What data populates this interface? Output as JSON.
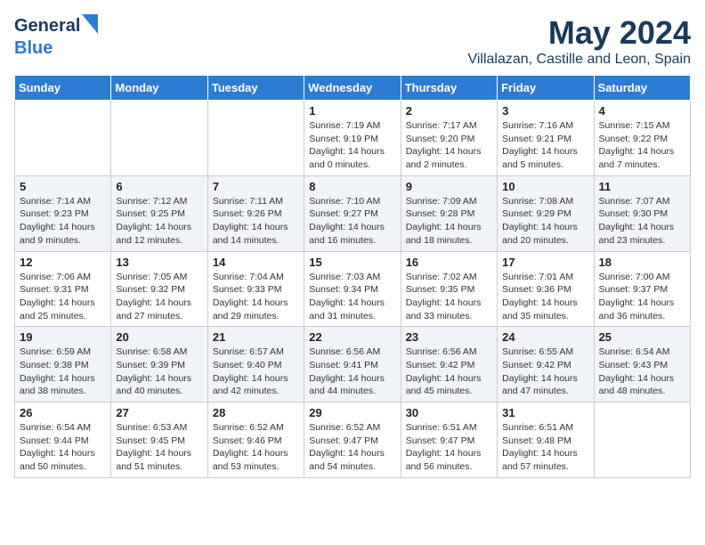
{
  "logo": {
    "general": "General",
    "blue": "Blue"
  },
  "title": "May 2024",
  "location": "Villalazan, Castille and Leon, Spain",
  "days_of_week": [
    "Sunday",
    "Monday",
    "Tuesday",
    "Wednesday",
    "Thursday",
    "Friday",
    "Saturday"
  ],
  "weeks": [
    [
      {
        "day": "",
        "info": ""
      },
      {
        "day": "",
        "info": ""
      },
      {
        "day": "",
        "info": ""
      },
      {
        "day": "1",
        "info": "Sunrise: 7:19 AM\nSunset: 9:19 PM\nDaylight: 14 hours and 0 minutes."
      },
      {
        "day": "2",
        "info": "Sunrise: 7:17 AM\nSunset: 9:20 PM\nDaylight: 14 hours and 2 minutes."
      },
      {
        "day": "3",
        "info": "Sunrise: 7:16 AM\nSunset: 9:21 PM\nDaylight: 14 hours and 5 minutes."
      },
      {
        "day": "4",
        "info": "Sunrise: 7:15 AM\nSunset: 9:22 PM\nDaylight: 14 hours and 7 minutes."
      }
    ],
    [
      {
        "day": "5",
        "info": "Sunrise: 7:14 AM\nSunset: 9:23 PM\nDaylight: 14 hours and 9 minutes."
      },
      {
        "day": "6",
        "info": "Sunrise: 7:12 AM\nSunset: 9:25 PM\nDaylight: 14 hours and 12 minutes."
      },
      {
        "day": "7",
        "info": "Sunrise: 7:11 AM\nSunset: 9:26 PM\nDaylight: 14 hours and 14 minutes."
      },
      {
        "day": "8",
        "info": "Sunrise: 7:10 AM\nSunset: 9:27 PM\nDaylight: 14 hours and 16 minutes."
      },
      {
        "day": "9",
        "info": "Sunrise: 7:09 AM\nSunset: 9:28 PM\nDaylight: 14 hours and 18 minutes."
      },
      {
        "day": "10",
        "info": "Sunrise: 7:08 AM\nSunset: 9:29 PM\nDaylight: 14 hours and 20 minutes."
      },
      {
        "day": "11",
        "info": "Sunrise: 7:07 AM\nSunset: 9:30 PM\nDaylight: 14 hours and 23 minutes."
      }
    ],
    [
      {
        "day": "12",
        "info": "Sunrise: 7:06 AM\nSunset: 9:31 PM\nDaylight: 14 hours and 25 minutes."
      },
      {
        "day": "13",
        "info": "Sunrise: 7:05 AM\nSunset: 9:32 PM\nDaylight: 14 hours and 27 minutes."
      },
      {
        "day": "14",
        "info": "Sunrise: 7:04 AM\nSunset: 9:33 PM\nDaylight: 14 hours and 29 minutes."
      },
      {
        "day": "15",
        "info": "Sunrise: 7:03 AM\nSunset: 9:34 PM\nDaylight: 14 hours and 31 minutes."
      },
      {
        "day": "16",
        "info": "Sunrise: 7:02 AM\nSunset: 9:35 PM\nDaylight: 14 hours and 33 minutes."
      },
      {
        "day": "17",
        "info": "Sunrise: 7:01 AM\nSunset: 9:36 PM\nDaylight: 14 hours and 35 minutes."
      },
      {
        "day": "18",
        "info": "Sunrise: 7:00 AM\nSunset: 9:37 PM\nDaylight: 14 hours and 36 minutes."
      }
    ],
    [
      {
        "day": "19",
        "info": "Sunrise: 6:59 AM\nSunset: 9:38 PM\nDaylight: 14 hours and 38 minutes."
      },
      {
        "day": "20",
        "info": "Sunrise: 6:58 AM\nSunset: 9:39 PM\nDaylight: 14 hours and 40 minutes."
      },
      {
        "day": "21",
        "info": "Sunrise: 6:57 AM\nSunset: 9:40 PM\nDaylight: 14 hours and 42 minutes."
      },
      {
        "day": "22",
        "info": "Sunrise: 6:56 AM\nSunset: 9:41 PM\nDaylight: 14 hours and 44 minutes."
      },
      {
        "day": "23",
        "info": "Sunrise: 6:56 AM\nSunset: 9:42 PM\nDaylight: 14 hours and 45 minutes."
      },
      {
        "day": "24",
        "info": "Sunrise: 6:55 AM\nSunset: 9:42 PM\nDaylight: 14 hours and 47 minutes."
      },
      {
        "day": "25",
        "info": "Sunrise: 6:54 AM\nSunset: 9:43 PM\nDaylight: 14 hours and 48 minutes."
      }
    ],
    [
      {
        "day": "26",
        "info": "Sunrise: 6:54 AM\nSunset: 9:44 PM\nDaylight: 14 hours and 50 minutes."
      },
      {
        "day": "27",
        "info": "Sunrise: 6:53 AM\nSunset: 9:45 PM\nDaylight: 14 hours and 51 minutes."
      },
      {
        "day": "28",
        "info": "Sunrise: 6:52 AM\nSunset: 9:46 PM\nDaylight: 14 hours and 53 minutes."
      },
      {
        "day": "29",
        "info": "Sunrise: 6:52 AM\nSunset: 9:47 PM\nDaylight: 14 hours and 54 minutes."
      },
      {
        "day": "30",
        "info": "Sunrise: 6:51 AM\nSunset: 9:47 PM\nDaylight: 14 hours and 56 minutes."
      },
      {
        "day": "31",
        "info": "Sunrise: 6:51 AM\nSunset: 9:48 PM\nDaylight: 14 hours and 57 minutes."
      },
      {
        "day": "",
        "info": ""
      }
    ]
  ]
}
